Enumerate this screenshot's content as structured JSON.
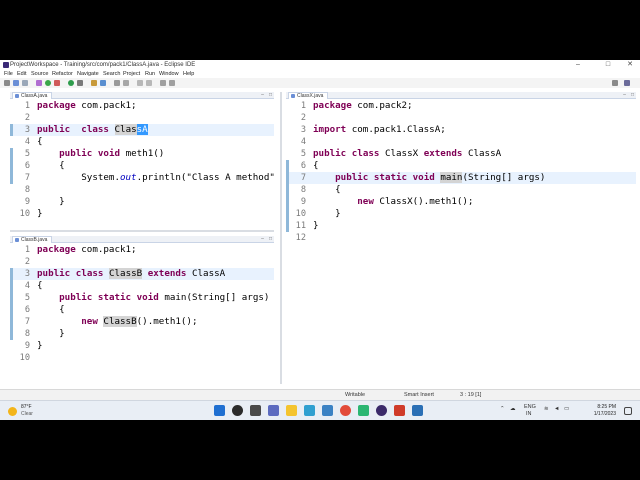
{
  "window": {
    "title": "ProjectWorkspace - Training/src/com/pack1/ClassA.java - Eclipse IDE",
    "minimize_glyph": "–",
    "maximize_glyph": "□",
    "close_glyph": "✕"
  },
  "menu": [
    "File",
    "Edit",
    "Source",
    "Refactor",
    "Navigate",
    "Search",
    "Project",
    "Run",
    "Window",
    "Help"
  ],
  "editors": {
    "classA": {
      "tab": "ClassA.java",
      "lines": [
        {
          "n": "1",
          "parts": [
            {
              "k": "kw",
              "t": "package"
            },
            {
              "k": "",
              "t": " com.pack1;"
            }
          ]
        },
        {
          "n": "2",
          "parts": []
        },
        {
          "n": "3",
          "parts": [
            {
              "k": "kw",
              "t": "public"
            },
            {
              "k": "",
              "t": "  "
            },
            {
              "k": "kw",
              "t": "class"
            },
            {
              "k": "",
              "t": " "
            },
            {
              "k": "occ",
              "t": "Clas"
            },
            {
              "k": "sel",
              "t": "sA"
            }
          ]
        },
        {
          "n": "4",
          "parts": [
            {
              "k": "",
              "t": "{"
            }
          ]
        },
        {
          "n": "5",
          "parts": [
            {
              "k": "",
              "t": "    "
            },
            {
              "k": "kw",
              "t": "public"
            },
            {
              "k": "",
              "t": " "
            },
            {
              "k": "kw",
              "t": "void"
            },
            {
              "k": "",
              "t": " meth1()"
            }
          ]
        },
        {
          "n": "6",
          "parts": [
            {
              "k": "",
              "t": "    {"
            }
          ]
        },
        {
          "n": "7",
          "parts": [
            {
              "k": "",
              "t": "        System."
            },
            {
              "k": "it",
              "t": "out"
            },
            {
              "k": "",
              "t": ".println(\"Class A method\");"
            }
          ]
        },
        {
          "n": "8",
          "parts": []
        },
        {
          "n": "9",
          "parts": [
            {
              "k": "",
              "t": "    }"
            }
          ]
        },
        {
          "n": "10",
          "parts": [
            {
              "k": "",
              "t": "}"
            }
          ]
        }
      ]
    },
    "classB": {
      "tab": "ClassB.java",
      "lines": [
        {
          "n": "1",
          "parts": [
            {
              "k": "kw",
              "t": "package"
            },
            {
              "k": "",
              "t": " com.pack1;"
            }
          ]
        },
        {
          "n": "2",
          "parts": []
        },
        {
          "n": "3",
          "parts": [
            {
              "k": "kw",
              "t": "public"
            },
            {
              "k": "",
              "t": " "
            },
            {
              "k": "kw",
              "t": "class"
            },
            {
              "k": "",
              "t": " "
            },
            {
              "k": "occ",
              "t": "ClassB"
            },
            {
              "k": "",
              "t": " "
            },
            {
              "k": "kw",
              "t": "extends"
            },
            {
              "k": "",
              "t": " ClassA"
            }
          ]
        },
        {
          "n": "4",
          "parts": [
            {
              "k": "",
              "t": "{"
            }
          ]
        },
        {
          "n": "5",
          "parts": [
            {
              "k": "",
              "t": "    "
            },
            {
              "k": "kw",
              "t": "public"
            },
            {
              "k": "",
              "t": " "
            },
            {
              "k": "kw",
              "t": "static"
            },
            {
              "k": "",
              "t": " "
            },
            {
              "k": "kw",
              "t": "void"
            },
            {
              "k": "",
              "t": " main(String[] args)"
            }
          ]
        },
        {
          "n": "6",
          "parts": [
            {
              "k": "",
              "t": "    {"
            }
          ]
        },
        {
          "n": "7",
          "parts": [
            {
              "k": "",
              "t": "        "
            },
            {
              "k": "kw",
              "t": "new"
            },
            {
              "k": "",
              "t": " "
            },
            {
              "k": "occ",
              "t": "ClassB"
            },
            {
              "k": "",
              "t": "().meth1();"
            }
          ]
        },
        {
          "n": "8",
          "parts": [
            {
              "k": "",
              "t": "    }"
            }
          ]
        },
        {
          "n": "9",
          "parts": [
            {
              "k": "",
              "t": "}"
            }
          ]
        },
        {
          "n": "10",
          "parts": []
        }
      ]
    },
    "classX": {
      "tab": "ClassX.java",
      "lines": [
        {
          "n": "1",
          "parts": [
            {
              "k": "kw",
              "t": "package"
            },
            {
              "k": "",
              "t": " com.pack2;"
            }
          ]
        },
        {
          "n": "2",
          "parts": []
        },
        {
          "n": "3",
          "parts": [
            {
              "k": "kw",
              "t": "import"
            },
            {
              "k": "",
              "t": " com.pack1.ClassA;"
            }
          ]
        },
        {
          "n": "4",
          "parts": []
        },
        {
          "n": "5",
          "parts": [
            {
              "k": "kw",
              "t": "public"
            },
            {
              "k": "",
              "t": " "
            },
            {
              "k": "kw",
              "t": "class"
            },
            {
              "k": "",
              "t": " ClassX "
            },
            {
              "k": "kw",
              "t": "extends"
            },
            {
              "k": "",
              "t": " ClassA"
            }
          ]
        },
        {
          "n": "6",
          "parts": [
            {
              "k": "",
              "t": "{"
            }
          ]
        },
        {
          "n": "7",
          "parts": [
            {
              "k": "",
              "t": "    "
            },
            {
              "k": "kw",
              "t": "public"
            },
            {
              "k": "",
              "t": " "
            },
            {
              "k": "kw",
              "t": "static"
            },
            {
              "k": "",
              "t": " "
            },
            {
              "k": "kw",
              "t": "void"
            },
            {
              "k": "",
              "t": " "
            },
            {
              "k": "occ",
              "t": "main"
            },
            {
              "k": "",
              "t": "(String[] args)"
            }
          ]
        },
        {
          "n": "8",
          "parts": [
            {
              "k": "",
              "t": "    {"
            }
          ]
        },
        {
          "n": "9",
          "parts": [
            {
              "k": "",
              "t": "        "
            },
            {
              "k": "kw",
              "t": "new"
            },
            {
              "k": "",
              "t": " ClassX().meth1();"
            }
          ]
        },
        {
          "n": "10",
          "parts": [
            {
              "k": "",
              "t": "    }"
            }
          ]
        },
        {
          "n": "11",
          "parts": [
            {
              "k": "",
              "t": "}"
            }
          ]
        },
        {
          "n": "12",
          "parts": []
        }
      ]
    }
  },
  "status": {
    "writable": "Writable",
    "insert_mode": "Smart Insert",
    "position": "3 : 19 [1]"
  },
  "taskbar": {
    "weather_temp": "87°F",
    "weather_cond": "Clear",
    "language": "ENG",
    "region": "IN",
    "time": "8:25 PM",
    "date": "1/17/2023"
  },
  "colors": {
    "keyword": "#7f0055",
    "static_field": "#0000c0",
    "selection": "#3399ff",
    "occurrence": "#d4d4d4",
    "current_line": "#e8f2fe"
  }
}
